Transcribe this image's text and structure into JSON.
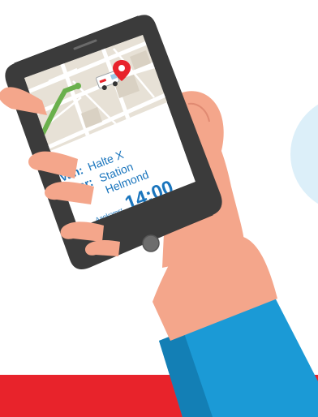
{
  "colors": {
    "background": "#ffffff",
    "bottom_bar": "#e8232b",
    "skin": "#f4a68b",
    "skin_shadow": "#e08a72",
    "phone_body": "#3b3b3b",
    "map": "#e7e1d6",
    "route": "#6ab04c",
    "screen_text": "#1a75bd",
    "sleeve": "#1b9ad6",
    "sleeve_dark": "#137fb5",
    "bubble": "#dceff9"
  },
  "icons": {
    "vehicle": "ambulance-van-icon",
    "location": "map-pin-icon",
    "home_button": "home-button-icon"
  },
  "trip": {
    "from_label": "Van:",
    "from_value": "Halte X",
    "to_label": "Naar:",
    "to_value_line1": "Station",
    "to_value_line2": "Helmond",
    "arrival_label": "Aankomst",
    "arrival_time": "14:00"
  }
}
